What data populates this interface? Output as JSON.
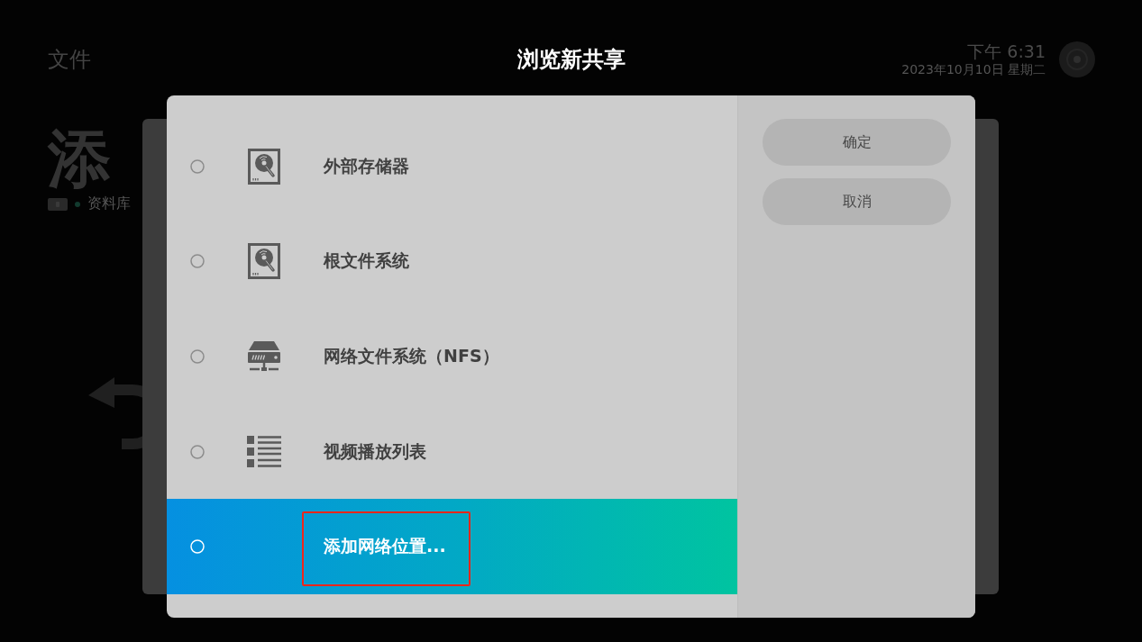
{
  "app_bar": {
    "title": "文件",
    "clock": {
      "time": "下午 6:31",
      "date": "2023年10月10日 星期二"
    }
  },
  "page": {
    "heading": "添",
    "breadcrumb": "资料库"
  },
  "dialog": {
    "title": "浏览新共享",
    "sources": [
      {
        "label": "外部存储器",
        "kind": "drive",
        "selected": false,
        "outlined": false
      },
      {
        "label": "根文件系统",
        "kind": "drive",
        "selected": false,
        "outlined": false
      },
      {
        "label": "网络文件系统（NFS）",
        "kind": "server",
        "selected": false,
        "outlined": false
      },
      {
        "label": "视频播放列表",
        "kind": "playlist",
        "selected": false,
        "outlined": false
      },
      {
        "label": "添加网络位置...",
        "kind": "add",
        "selected": true,
        "outlined": true
      }
    ],
    "buttons": [
      "确定",
      "取消"
    ]
  }
}
